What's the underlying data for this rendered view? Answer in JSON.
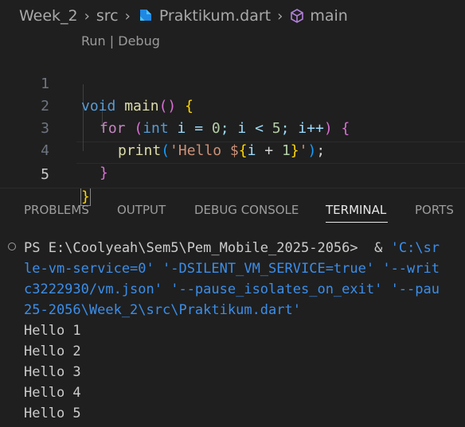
{
  "breadcrumb": {
    "folder1": "Week_2",
    "folder2": "src",
    "file": "Praktikum.dart",
    "symbol": "main"
  },
  "editor": {
    "codelens": "Run | Debug",
    "line_numbers": [
      "1",
      "2",
      "3",
      "4",
      "5"
    ],
    "code": {
      "l1_void": "void",
      "l1_main": "main",
      "l1_parens": "()",
      "l1_brace": "{",
      "l2_for": "for",
      "l2_open": "(",
      "l2_int": "int",
      "l2_rest_a": " i = ",
      "l2_zero": "0",
      "l2_rest_b": "; i < ",
      "l2_five": "5",
      "l2_rest_c": "; i++",
      "l2_close": ")",
      "l2_brace": "{",
      "l3_print": "print",
      "l3_open": "(",
      "l3_str_a": "'Hello $",
      "l3_interp_open": "{",
      "l3_i": "i",
      "l3_plus": " + ",
      "l3_one": "1",
      "l3_interp_close": "}",
      "l3_str_b": "'",
      "l3_close": ")",
      "l3_semi": ";",
      "l4_brace": "}",
      "l5_brace": "}"
    }
  },
  "panel": {
    "tabs": [
      "PROBLEMS",
      "OUTPUT",
      "DEBUG CONSOLE",
      "TERMINAL",
      "PORTS"
    ],
    "active_tab": "TERMINAL"
  },
  "terminal": {
    "prompt": "PS E:\\Coolyeah\\Sem5\\Pem_Mobile_2025-2056>",
    "cmd_amp": "&",
    "cmd_part1": "'C:\\sr",
    "cmd_line2": "le-vm-service=0' '-DSILENT_VM_SERVICE=true' '--writ",
    "cmd_line3": "c3222930/vm.json' '--pause_isolates_on_exit' '--pau",
    "cmd_line4": "25-2056\\Week_2\\src\\Praktikum.dart'",
    "output": [
      "Hello 1",
      "Hello 2",
      "Hello 3",
      "Hello 4",
      "Hello 5"
    ]
  }
}
